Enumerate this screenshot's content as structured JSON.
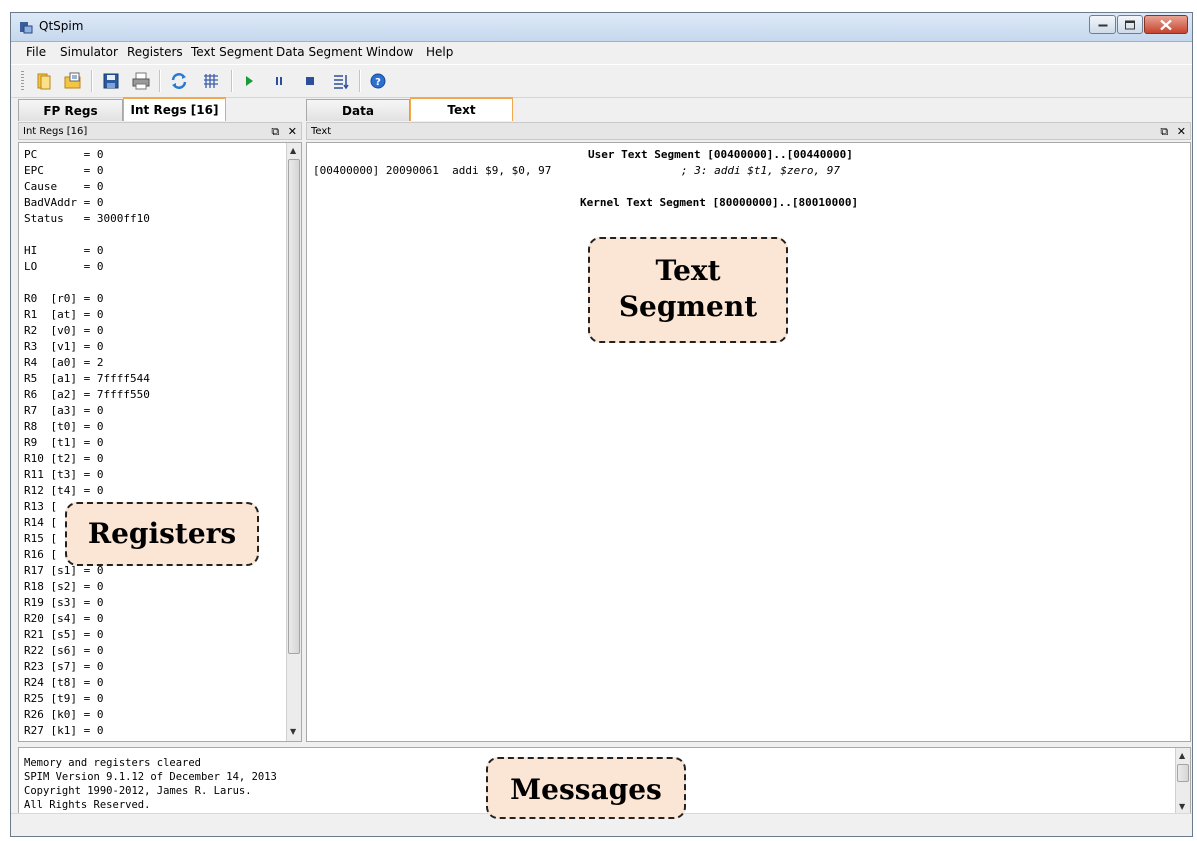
{
  "window": {
    "title": "QtSpim"
  },
  "menu": [
    "File",
    "Simulator",
    "Registers",
    "Text Segment",
    "Data Segment",
    "Window",
    "Help"
  ],
  "toolbar": {
    "icons": [
      "open-file-icon",
      "reload-file-icon",
      "save-icon",
      "print-icon",
      "clear-icon",
      "grid-icon",
      "run-icon",
      "pause-icon",
      "stop-icon",
      "single-step-icon",
      "help-icon"
    ]
  },
  "left_tabs": [
    {
      "label": "FP Regs"
    },
    {
      "label": "Int Regs [16]"
    }
  ],
  "left_dock_title": "Int Regs [16]",
  "registers": [
    "PC       = 0",
    "EPC      = 0",
    "Cause    = 0",
    "BadVAddr = 0",
    "Status   = 3000ff10",
    "",
    "HI       = 0",
    "LO       = 0",
    "",
    "R0  [r0] = 0",
    "R1  [at] = 0",
    "R2  [v0] = 0",
    "R3  [v1] = 0",
    "R4  [a0] = 2",
    "R5  [a1] = 7ffff544",
    "R6  [a2] = 7ffff550",
    "R7  [a3] = 0",
    "R8  [t0] = 0",
    "R9  [t1] = 0",
    "R10 [t2] = 0",
    "R11 [t3] = 0",
    "R12 [t4] = 0",
    "R13 [",
    "R14 [",
    "R15 [",
    "R16 [",
    "R17 [s1] = 0",
    "R18 [s2] = 0",
    "R19 [s3] = 0",
    "R20 [s4] = 0",
    "R21 [s5] = 0",
    "R22 [s6] = 0",
    "R23 [s7] = 0",
    "R24 [t8] = 0",
    "R25 [t9] = 0",
    "R26 [k0] = 0",
    "R27 [k1] = 0"
  ],
  "right_tabs": [
    {
      "label": "Data"
    },
    {
      "label": "Text"
    }
  ],
  "right_dock_title": "Text",
  "text_segment": {
    "user_header": "User Text Segment [00400000]..[00440000]",
    "instruction": "[00400000] 20090061  addi $9, $0, 97",
    "comment": "; 3: addi $t1, $zero, 97",
    "kernel_header": "Kernel Text Segment [80000000]..[80010000]"
  },
  "messages": [
    "Memory and registers cleared",
    "SPIM Version 9.1.12 of December 14, 2013",
    "Copyright 1990-2012, James R. Larus.",
    "All Rights Reserved."
  ],
  "callouts": {
    "text_segment_line1": "Text",
    "text_segment_line2": "Segment",
    "registers": "Registers",
    "messages": "Messages"
  }
}
